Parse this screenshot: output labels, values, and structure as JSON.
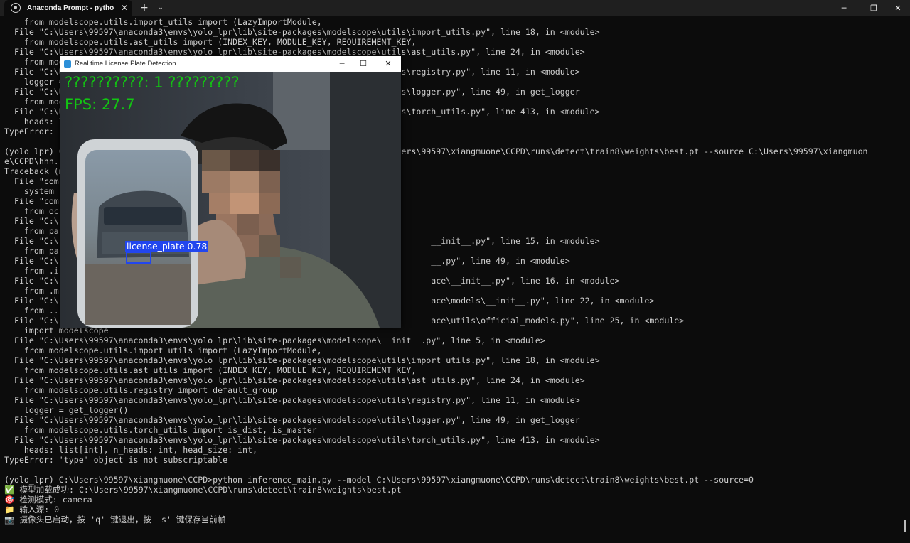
{
  "window": {
    "tab_title": "Anaconda Prompt - python  in",
    "tab_close": "✕",
    "new_tab": "+",
    "tab_menu": "⌄",
    "minimize": "─",
    "maximize": "❐",
    "close": "✕"
  },
  "terminal": {
    "lines": [
      "    from modelscope.utils.import_utils import (LazyImportModule,",
      "  File \"C:\\Users\\99597\\anaconda3\\envs\\yolo_lpr\\lib\\site-packages\\modelscope\\utils\\import_utils.py\", line 18, in <module>",
      "    from modelscope.utils.ast_utils import (INDEX_KEY, MODULE_KEY, REQUIREMENT_KEY,",
      "  File \"C:\\Users\\99597\\anaconda3\\envs\\yolo_lpr\\lib\\site-packages\\modelscope\\utils\\ast_utils.py\", line 24, in <module>",
      "    from modelscope.utils.registry import default_group",
      "  File \"C:\\Users\\99597\\anaconda3\\envs\\yolo_lpr\\lib\\site-packages\\modelscope\\utils\\registry.py\", line 11, in <module>",
      "    logger = get_logger()",
      "  File \"C:\\Users\\99597\\anaconda3\\envs\\yolo_lpr\\lib\\site-packages\\modelscope\\utils\\logger.py\", line 49, in get_logger",
      "    from modelscope.utils.torch_utils import is_dist, is_master",
      "  File \"C:\\Users\\99597\\anaconda3\\envs\\yolo_lpr\\lib\\site-packages\\modelscope\\utils\\torch_utils.py\", line 413, in <module>",
      "    heads: list[int], n_heads: int, head_size: int,",
      "TypeError: 'type' object is not subscriptable",
      "",
      "(yolo_lpr) C:\\Users\\99597\\xiangmuone\\CCPD>python inference_main.py --model C:\\Users\\99597\\xiangmuone\\CCPD\\runs\\detect\\train8\\weights\\best.pt --source C:\\Users\\99597\\xiangmuon",
      "e\\CCPD\\hhh.",
      "Traceback (most recent call last):",
      "  File \"com",
      "    system",
      "  File \"com",
      "    from oc",
      "  File \"C:\\",
      "    from pa",
      "  File \"C:\\                                                                           __init__.py\", line 15, in <module>",
      "    from pa",
      "  File \"C:\\                                                                           __.py\", line 49, in <module>",
      "    from .i",
      "  File \"C:\\                                                                           ace\\__init__.py\", line 16, in <module>",
      "    from .m",
      "  File \"C:\\                                                                           ace\\models\\__init__.py\", line 22, in <module>",
      "    from ..",
      "  File \"C:\\                                                                           ace\\utils\\official_models.py\", line 25, in <module>",
      "    import modelscope",
      "  File \"C:\\Users\\99597\\anaconda3\\envs\\yolo_lpr\\lib\\site-packages\\modelscope\\__init__.py\", line 5, in <module>",
      "    from modelscope.utils.import_utils import (LazyImportModule,",
      "  File \"C:\\Users\\99597\\anaconda3\\envs\\yolo_lpr\\lib\\site-packages\\modelscope\\utils\\import_utils.py\", line 18, in <module>",
      "    from modelscope.utils.ast_utils import (INDEX_KEY, MODULE_KEY, REQUIREMENT_KEY,",
      "  File \"C:\\Users\\99597\\anaconda3\\envs\\yolo_lpr\\lib\\site-packages\\modelscope\\utils\\ast_utils.py\", line 24, in <module>",
      "    from modelscope.utils.registry import default_group",
      "  File \"C:\\Users\\99597\\anaconda3\\envs\\yolo_lpr\\lib\\site-packages\\modelscope\\utils\\registry.py\", line 11, in <module>",
      "    logger = get_logger()",
      "  File \"C:\\Users\\99597\\anaconda3\\envs\\yolo_lpr\\lib\\site-packages\\modelscope\\utils\\logger.py\", line 49, in get_logger",
      "    from modelscope.utils.torch_utils import is_dist, is_master",
      "  File \"C:\\Users\\99597\\anaconda3\\envs\\yolo_lpr\\lib\\site-packages\\modelscope\\utils\\torch_utils.py\", line 413, in <module>",
      "    heads: list[int], n_heads: int, head_size: int,",
      "TypeError: 'type' object is not subscriptable",
      "",
      "(yolo_lpr) C:\\Users\\99597\\xiangmuone\\CCPD>python inference_main.py --model C:\\Users\\99597\\xiangmuone\\CCPD\\runs\\detect\\train8\\weights\\best.pt --source=0",
      "✅ 模型加载成功: C:\\Users\\99597\\xiangmuone\\CCPD\\runs\\detect\\train8\\weights\\best.pt",
      "🎯 检测模式: camera",
      "📁 输入源: 0",
      "📷 摄像头已启动，按 'q' 键退出，按 's' 键保存当前帧"
    ]
  },
  "cv_window": {
    "title": "Real time License Plate Detection",
    "minimize": "─",
    "maximize": "☐",
    "close": "✕",
    "overlay_status": "??????????: 1 ?????????",
    "overlay_fps": "FPS: 27.7",
    "detection_label": "license_plate 0.78",
    "detection_confidence": 0.78
  },
  "colors": {
    "terminal_bg": "#0c0c0c",
    "terminal_text": "#cccccc",
    "overlay_green": "#12c512",
    "detection_blue": "#2246ee"
  }
}
